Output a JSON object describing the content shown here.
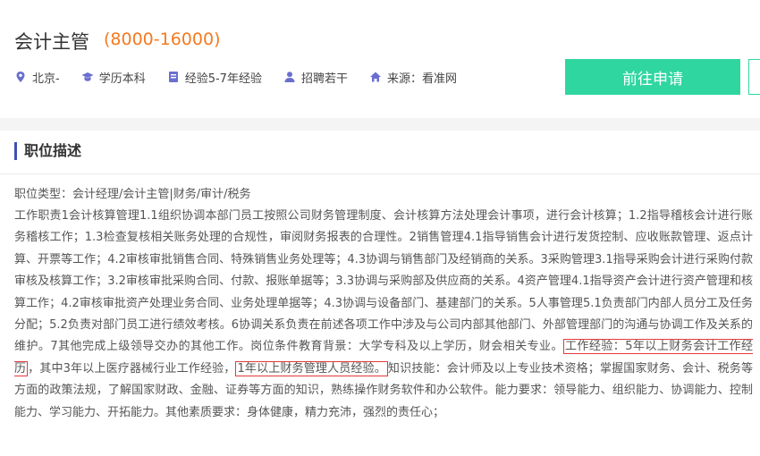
{
  "job": {
    "title": "会计主管",
    "salary": "(8000-16000)"
  },
  "meta": {
    "location": "北京-",
    "education": "学历本科",
    "experience": "经验5-7年经验",
    "headcount": "招聘若干",
    "source": "来源：看准网"
  },
  "icons": {
    "location": "map-pin-icon",
    "education": "graduation-cap-icon",
    "experience": "document-icon",
    "headcount": "person-icon",
    "source": "home-icon"
  },
  "apply_button": {
    "label": "前往申请"
  },
  "section": {
    "title": "职位描述"
  },
  "description": {
    "job_type": "职位类型：会计经理/会计主管|财务/审计/税务",
    "part1": "工作职责1会计核算管理1.1组织协调本部门员工按照公司财务管理制度、会计核算方法处理会计事项，进行会计核算；1.2指导稽核会计进行账务稽核工作；1.3检查复核相关账务处理的合规性，审阅财务报表的合理性。2销售管理4.1指导销售会计进行发货控制、应收账款管理、返点计算、开票等工作；4.2审核审批销售合同、特殊销售业务处理等；4.3协调与销售部门及经销商的关系。3采购管理3.1指导采购会计进行采购付款审核及核算工作；3.2审核审批采购合同、付款、报账单据等；3.3协调与采购部及供应商的关系。4资产管理4.1指导资产会计进行资产管理和核算工作；4.2审核审批资产处理业务合同、业务处理单据等；4.3协调与设备部门、基建部门的关系。5人事管理5.1负责部门内部人员分工及任务分配；5.2负责对部门员工进行绩效考核。6协调关系负责在前述各项工作中涉及与公司内部其他部门、外部管理部门的沟通与协调工作及关系的维护。7其他完成上级领导交办的其他工作。岗位条件教育背景：大学专科及以上学历，财会相关专业。",
    "highlight1": "工作经验：5年以上财务会计工作经历",
    "part2": "，其中3年以上医疗器械行业工作经验，",
    "highlight2": "1年以上财务管理人员经验。",
    "part3": "知识技能：会计师及以上专业技术资格；掌握国家财务、会计、税务等方面的政策法规，了解国家财政、金融、证券等方面的知识，熟练操作财务软件和办公软件。能力要求：领导能力、组织能力、协调能力、控制能力、学习能力、开拓能力。其他素质要求：身体健康，精力充沛，强烈的责任心；"
  },
  "colors": {
    "salary": "#f47a20",
    "button": "#2fd6a0",
    "accent_bar": "#3f51b5",
    "highlight_border": "#e4393c",
    "icon": "#6a6fcf"
  }
}
